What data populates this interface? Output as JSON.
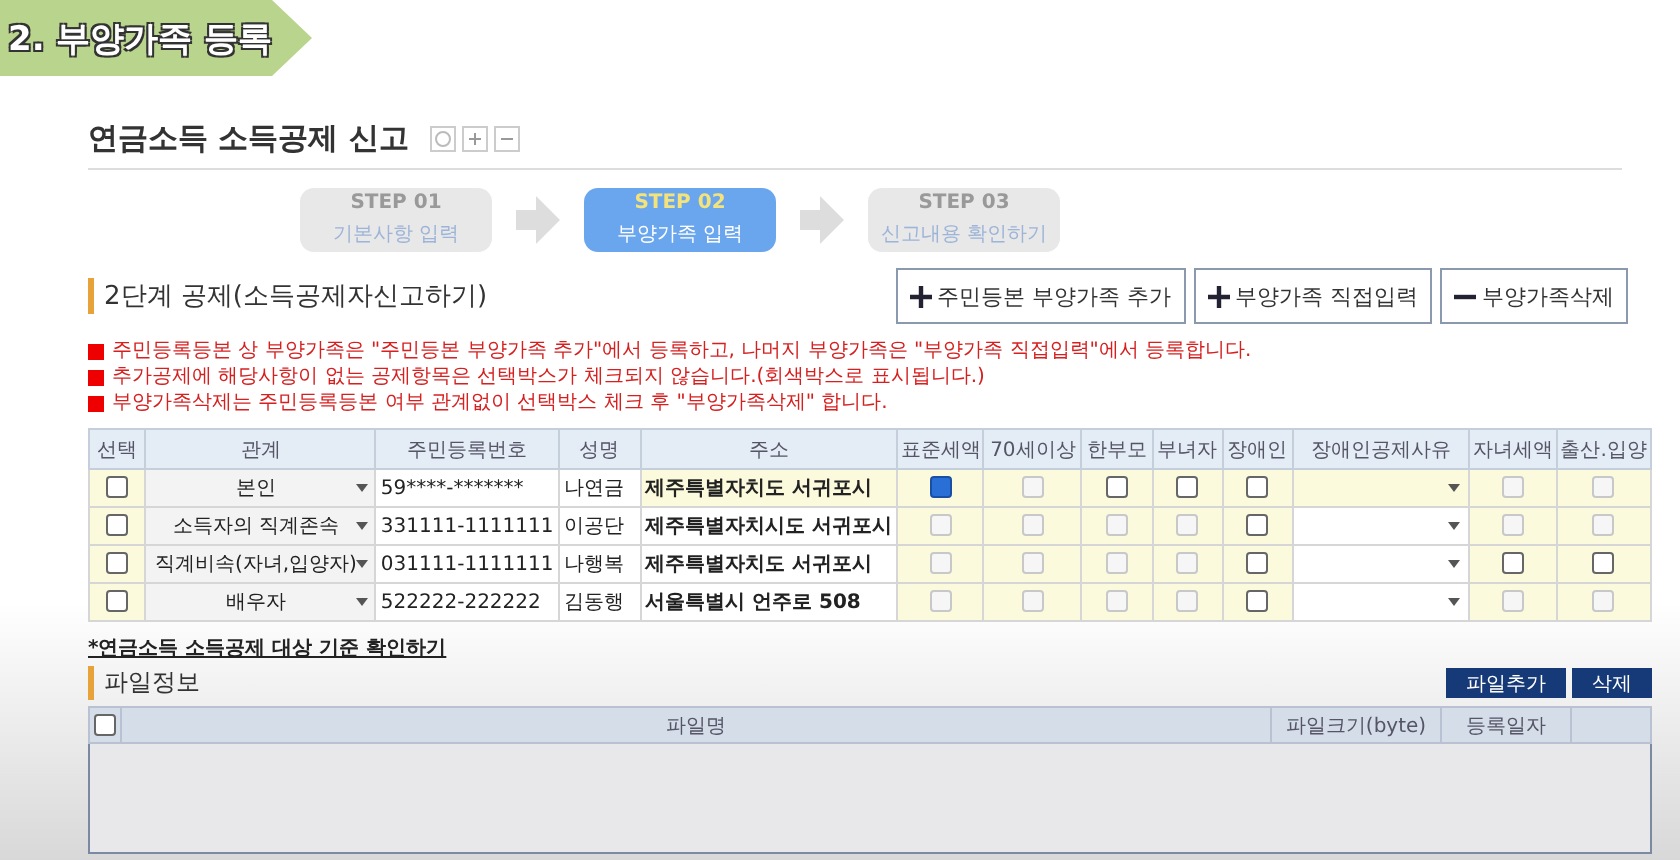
{
  "banner": {
    "title": "2. 부양가족 등록"
  },
  "page": {
    "title": "연금소득 소득공제 신고"
  },
  "steps": [
    {
      "step": "STEP 01",
      "label": "기본사항 입력",
      "selected": false
    },
    {
      "step": "STEP 02",
      "label": "부양가족 입력",
      "selected": true
    },
    {
      "step": "STEP 03",
      "label": "신고내용 확인하기",
      "selected": false
    }
  ],
  "section": {
    "title": "2단계 공제(소득공제자신고하기)"
  },
  "actions": [
    {
      "kind": "plus",
      "label": "주민등본 부양가족 추가"
    },
    {
      "kind": "plus",
      "label": "부양가족 직접입력"
    },
    {
      "kind": "minus",
      "label": "부양가족삭제"
    }
  ],
  "notes": [
    "주민등록등본 상 부양가족은 \"주민등본 부양가족 추가\"에서 등록하고, 나머지 부양가족은 \"부양가족 직접입력\"에서 등록합니다.",
    "추가공제에 해당사항이 없는 공제항목은 선택박스가 체크되지 않습니다.(회색박스로 표시됩니다.)",
    "부양가족삭제는 주민등록등본 여부 관계없이 선택박스 체크 후 \"부양가족삭제\" 합니다."
  ],
  "table": {
    "columns": [
      "선택",
      "관계",
      "주민등록번호",
      "성명",
      "주소",
      "표준세액",
      "70세이상",
      "한부모",
      "부녀자",
      "장애인",
      "장애인공제사유",
      "자녀세액",
      "출산.입양"
    ],
    "rows": [
      {
        "checked": false,
        "relation": "본인",
        "id": "59****-*******",
        "name": "나연금",
        "address": "제주특별자치도 서귀포시",
        "highlighted": true,
        "flags": [
          {
            "checked": true,
            "disabled": false
          },
          {
            "checked": false,
            "disabled": true
          },
          {
            "checked": false,
            "disabled": false
          },
          {
            "checked": false,
            "disabled": false
          },
          {
            "checked": false,
            "disabled": false
          },
          {
            "checked": false,
            "disabled": true
          },
          {
            "checked": false,
            "disabled": true
          }
        ]
      },
      {
        "checked": false,
        "relation": "소득자의 직계존속",
        "id": "331111-1111111",
        "name": "이공단",
        "address": "제주특별자치시도 서귀포시",
        "highlighted": false,
        "flags": [
          {
            "checked": false,
            "disabled": true
          },
          {
            "checked": false,
            "disabled": true
          },
          {
            "checked": false,
            "disabled": true
          },
          {
            "checked": false,
            "disabled": true
          },
          {
            "checked": false,
            "disabled": false
          },
          {
            "checked": false,
            "disabled": true
          },
          {
            "checked": false,
            "disabled": true
          }
        ]
      },
      {
        "checked": false,
        "relation": "직계비속(자녀,입양자)",
        "id": "031111-1111111",
        "name": "나행복",
        "address": "제주특별자치도 서귀포시",
        "highlighted": false,
        "flags": [
          {
            "checked": false,
            "disabled": true
          },
          {
            "checked": false,
            "disabled": true
          },
          {
            "checked": false,
            "disabled": true
          },
          {
            "checked": false,
            "disabled": true
          },
          {
            "checked": false,
            "disabled": false
          },
          {
            "checked": false,
            "disabled": false
          },
          {
            "checked": false,
            "disabled": false
          }
        ]
      },
      {
        "checked": false,
        "relation": "배우자",
        "id": "522222-222222",
        "name": "김동행",
        "address": "서울특별시 언주로 508",
        "highlighted": false,
        "flags": [
          {
            "checked": false,
            "disabled": true
          },
          {
            "checked": false,
            "disabled": true
          },
          {
            "checked": false,
            "disabled": true
          },
          {
            "checked": false,
            "disabled": true
          },
          {
            "checked": false,
            "disabled": false
          },
          {
            "checked": false,
            "disabled": true
          },
          {
            "checked": false,
            "disabled": true
          }
        ]
      }
    ]
  },
  "link": "*연금소득 소득공제 대상 기준 확인하기",
  "files": {
    "title": "파일정보",
    "all_checked": false,
    "buttons": [
      "파일추가",
      "삭제"
    ],
    "columns": [
      "파일명",
      "파일크기(byte)",
      "등록일자"
    ]
  }
}
